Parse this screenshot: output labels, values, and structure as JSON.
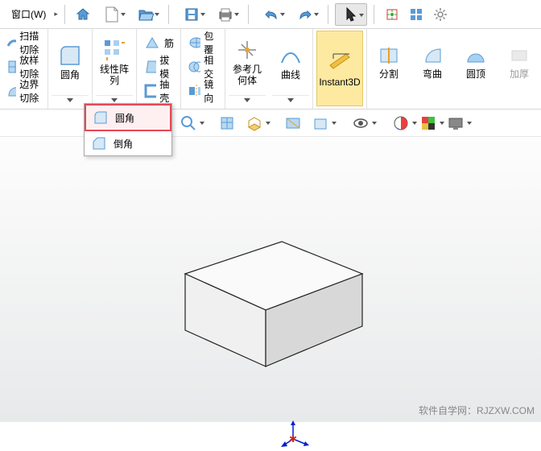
{
  "menu": {
    "window": "窗口(W)"
  },
  "ribbon": {
    "col1": [
      "扫描切除",
      "放样切除",
      "边界切除"
    ],
    "fillet": "圆角",
    "linear": "线性阵\n列",
    "rib": "筋",
    "draft": "拔模",
    "shell": "抽壳",
    "wrap": "包覆",
    "intersect": "相交",
    "mirror": "镜向",
    "refgeom": "参考几\n何体",
    "curve": "曲线",
    "instant": "Instant3D",
    "split": "分割",
    "bend": "弯曲",
    "dome": "圆顶",
    "thicken": "加厚"
  },
  "dropdown": {
    "fillet": "圆角",
    "chamfer": "倒角"
  },
  "watermark": "软件自学网：RJZXW.COM"
}
